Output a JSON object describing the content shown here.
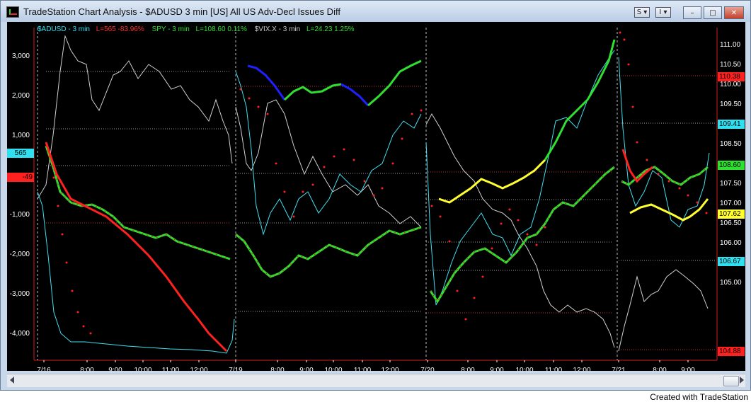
{
  "window": {
    "title": "TradeStation Chart Analysis - $ADUSD 3 min [US] All US Adv-Decl Issues Diff",
    "icon": "tradestation-app-icon",
    "toolbar_buttons": [
      "S",
      "I"
    ],
    "controls": [
      "minimize",
      "maximize",
      "close"
    ],
    "control_glyphs": {
      "minimize": "–",
      "maximize": "□",
      "close": "✕"
    }
  },
  "legend": [
    {
      "text": "$ADUSD - 3 min",
      "color": "#2de0f0"
    },
    {
      "text": "L=565  -83.96%",
      "color": "#ff3030"
    },
    {
      "text": "SPY - 3 min",
      "color": "#30e030"
    },
    {
      "text": "L=108.60  0.11%",
      "color": "#30e030"
    },
    {
      "text": "$VIX.X - 3 min",
      "color": "#c8c8c8"
    },
    {
      "text": "L=24.23  1.25%",
      "color": "#30e030"
    }
  ],
  "left_axis_ticks": [
    "3,000",
    "2,000",
    "1,000",
    "-1,000",
    "-2,000",
    "-3,000",
    "-4,000"
  ],
  "left_tags": [
    {
      "text": "565",
      "bg": "#30e0f0",
      "color": "#000"
    },
    {
      "text": "-49",
      "bg": "#ff2020",
      "color": "#000"
    }
  ],
  "right_axis_ticks": [
    "111.00",
    "110.50",
    "110.00",
    "109.50",
    "109.00",
    "108.50",
    "108.00",
    "107.50",
    "107.00",
    "106.50",
    "106.00",
    "105.50",
    "105.00"
  ],
  "right_tags": [
    {
      "text": "110.38",
      "bg": "#ff2020",
      "color": "#000"
    },
    {
      "text": "109.41",
      "bg": "#30e0f0",
      "color": "#000"
    },
    {
      "text": "108.60",
      "bg": "#30e030",
      "color": "#000"
    },
    {
      "text": "107.62",
      "bg": "#ffff30",
      "color": "#000"
    },
    {
      "text": "106.67",
      "bg": "#30e0f0",
      "color": "#000"
    },
    {
      "text": "104.88",
      "bg": "#ff2020",
      "color": "#000"
    }
  ],
  "time_labels": [
    "7/16",
    "8:00",
    "9:00",
    "10:00",
    "11:00",
    "12:00",
    "7/19",
    "8:00",
    "9:00",
    "10:00",
    "11:00",
    "12:00",
    "7/20",
    "8:00",
    "9:00",
    "10:00",
    "11:00",
    "12:00",
    "7/21",
    "8:00",
    "9:00"
  ],
  "footer": "Created with TradeStation",
  "chart_data": {
    "type": "line",
    "series": [
      {
        "name": "$ADUSD - 3 min",
        "last": 565,
        "change_pct": -83.96
      },
      {
        "name": "SPY - 3 min",
        "last": 108.6,
        "change_pct": 0.11
      },
      {
        "name": "$VIX.X - 3 min",
        "last": 24.23,
        "change_pct": 1.25
      }
    ],
    "y_left_range": [
      -4700,
      3600
    ],
    "y_right_range": [
      104.8,
      111.3
    ],
    "grid": false
  }
}
